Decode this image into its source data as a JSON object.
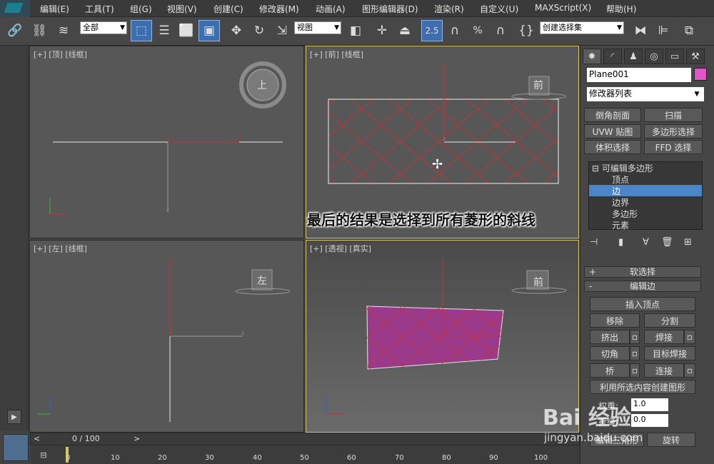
{
  "menu": [
    "编辑(E)",
    "工具(T)",
    "组(G)",
    "视图(V)",
    "创建(C)",
    "修改器(M)",
    "动画(A)",
    "图形编辑器(D)",
    "渲染(R)",
    "自定义(U)",
    "MAXScript(X)",
    "帮助(H)"
  ],
  "toolbar": {
    "selection_filter": "全部",
    "ref_coord": "视图",
    "snap_value": "2.5",
    "named_set": "创建选择集",
    "percent_label": "%"
  },
  "viewports": {
    "top": {
      "label": "[+] [顶] [线框]",
      "cube_label": "上"
    },
    "front": {
      "label": "[+] [前] [线框]",
      "cube_label": "前"
    },
    "left": {
      "label": "[+] [左] [线框]",
      "cube_label": "左"
    },
    "persp": {
      "label": "[+] [透视] [真实]",
      "cube_label": "前"
    }
  },
  "caption": "最后的结果是选择到所有菱形的斜线",
  "command_panel": {
    "object_name": "Plane001",
    "object_color": "#e055c8",
    "modifier_list": "修改器列表",
    "modifier_buttons": [
      "倒角剖面",
      "扫描",
      "UVW 贴图",
      "多边形选择",
      "体积选择",
      "FFD 选择"
    ],
    "stack": {
      "root": "可编辑多边形",
      "items": [
        "顶点",
        "边",
        "边界",
        "多边形",
        "元素"
      ],
      "selected_index": 1
    },
    "rollouts": {
      "soft_select": "软选择",
      "edit_edges": "编辑边",
      "soft_select_sign": "+",
      "edit_edges_sign": "-"
    },
    "edit_edge_buttons": {
      "insert_vertex": "插入顶点",
      "remove": "移除",
      "split": "分割",
      "extrude": "挤出",
      "weld": "焊接",
      "chamfer": "切角",
      "target_weld": "目标焊接",
      "bridge": "桥",
      "connect": "连接",
      "create_shape": "利用所选内容创建图形",
      "weight_label": "权重:",
      "weight_value": "1.0",
      "crease_label": "折缝:",
      "crease_value": "0.0",
      "edit_tri": "编辑三角形",
      "turn": "旋转"
    }
  },
  "timeline": {
    "frame": "0 / 100",
    "prev": "<",
    "next": ">",
    "ticks": [
      "0",
      "10",
      "20",
      "30",
      "40",
      "50",
      "60",
      "70",
      "80",
      "90",
      "100"
    ]
  },
  "watermark": {
    "brand": "Bai 经验",
    "url": "jingyan.baidu.com"
  },
  "colors": {
    "accent": "#3d6fb0",
    "selection": "#4a86c8",
    "axis_red": "#c0333a",
    "plane_fill": "#9b3a8a",
    "active_border": "#d7c56b"
  }
}
